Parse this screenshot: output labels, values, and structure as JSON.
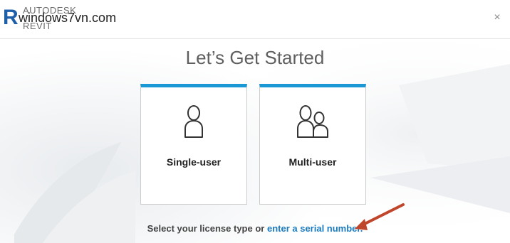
{
  "header": {
    "logo_letter": "R",
    "logo_brand": "AUTODESK",
    "logo_product": "REVIT",
    "watermark": "windows7vn.com",
    "close_label": "×"
  },
  "main": {
    "title": "Let’s Get Started",
    "options": [
      {
        "label": "Single-user",
        "icon": "single-user-icon"
      },
      {
        "label": "Multi-user",
        "icon": "multi-user-icon"
      }
    ]
  },
  "footer": {
    "prompt": "Select your license type or ",
    "link": "enter a serial number."
  },
  "colors": {
    "accent": "#1a98d5",
    "link": "#1a7bbf",
    "annotation_arrow": "#c0462b"
  }
}
